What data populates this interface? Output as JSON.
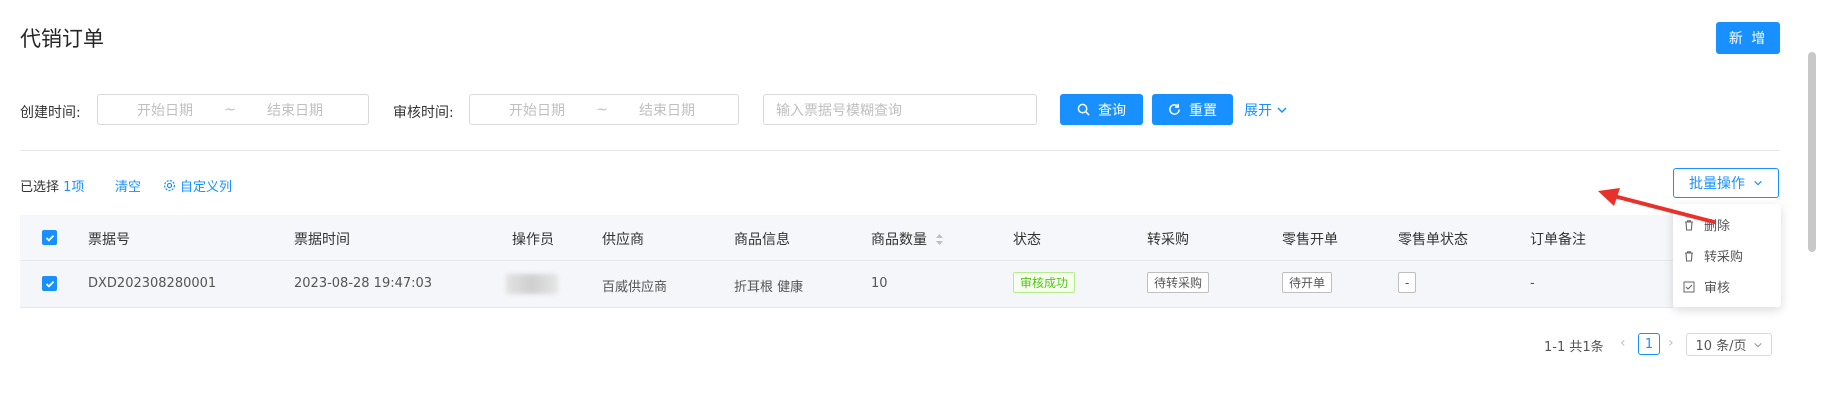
{
  "page": {
    "title": "代销订单",
    "new_button": "新 增"
  },
  "filters": {
    "created_label": "创建时间:",
    "created_start_placeholder": "开始日期",
    "created_sep": "~",
    "created_end_placeholder": "结束日期",
    "audit_label": "审核时间:",
    "audit_start_placeholder": "开始日期",
    "audit_sep": "~",
    "audit_end_placeholder": "结束日期",
    "search_placeholder": "输入票据号模糊查询",
    "search_button": "查询",
    "reset_button": "重置",
    "expand_link": "展开"
  },
  "toolbar": {
    "selected_text": "已选择",
    "selected_count": "1项",
    "clear_link": "清空",
    "custom_columns": "自定义列",
    "batch_button": "批量操作"
  },
  "batch_menu": [
    {
      "label": "删除",
      "icon": "trash-icon"
    },
    {
      "label": "转采购",
      "icon": "trash-icon"
    },
    {
      "label": "审核",
      "icon": "check-square-icon"
    }
  ],
  "table": {
    "headers": [
      "票据号",
      "票据时间",
      "操作员",
      "供应商",
      "商品信息",
      "商品数量",
      "状态",
      "转采购",
      "零售开单",
      "零售单状态",
      "订单备注"
    ],
    "rows": [
      {
        "ticket_no": "DXD202308280001",
        "ticket_time": "2023-08-28 19:47:03",
        "supplier": "百威供应商",
        "product_info": "折耳根 健康",
        "quantity": "10",
        "status": "审核成功",
        "purchase": "待转采购",
        "retail": "待开单",
        "retail_status": "-",
        "remark": "-"
      }
    ]
  },
  "pagination": {
    "summary": "1-1 共1条",
    "current_page": "1",
    "page_size": "10 条/页"
  },
  "colors": {
    "primary": "#1890ff",
    "success": "#52c41a",
    "arrow": "#e8312a"
  }
}
